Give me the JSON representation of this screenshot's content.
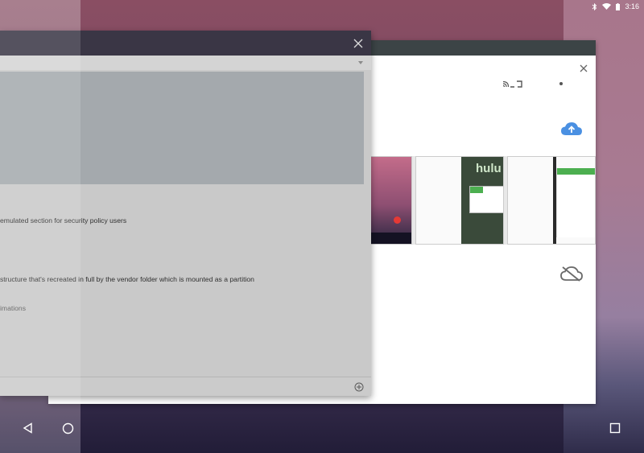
{
  "status_bar": {
    "time": "3:16",
    "icons": [
      "bluetooth-icon",
      "wifi-icon",
      "battery-icon"
    ]
  },
  "back_card": {
    "thumbnails": {
      "brand_text": "hulu"
    }
  },
  "front_card": {
    "lines": [
      "emulated section for security policy users",
      "structure that's recreated in full by the vendor folder which is mounted as a partition",
      "imations"
    ]
  },
  "navigation": {
    "icons": [
      "back-icon",
      "home-icon",
      "recents-icon"
    ]
  },
  "colors": {
    "accent_blue": "#4a90e2",
    "header_dark": "#3a3645",
    "card_header": "#3c4446"
  }
}
